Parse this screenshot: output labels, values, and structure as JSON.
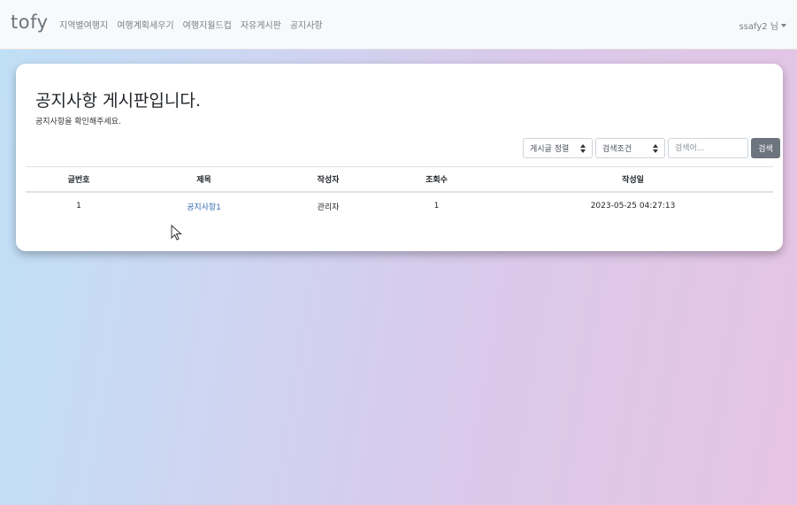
{
  "navbar": {
    "brand": "tofy",
    "links": [
      "지역별여행지",
      "여행계획세우기",
      "여행지월드컵",
      "자유게시판",
      "공지사항"
    ],
    "user": "ssafy2 님"
  },
  "board": {
    "title": "공지사항 게시판입니다.",
    "subtitle": "공지사항을 확인해주세요.",
    "sort_select": "게시글 정렬",
    "condition_select": "검색조건",
    "search_placeholder": "검색어...",
    "search_button": "검색"
  },
  "table": {
    "headers": [
      "글번호",
      "제목",
      "작성자",
      "조회수",
      "작성일"
    ],
    "rows": [
      {
        "no": "1",
        "title": "공지사항1",
        "author": "관리자",
        "views": "1",
        "date": "2023-05-25 04:27:13"
      }
    ]
  },
  "icons": {
    "dropdown": "caret-down-icon",
    "select_arrows": "sort-arrows-icon",
    "pointer": "mouse-cursor-icon"
  },
  "colors": {
    "navbar_bg": "#f8f9fa",
    "link": "#3a6fb0",
    "button": "#6c757d"
  }
}
